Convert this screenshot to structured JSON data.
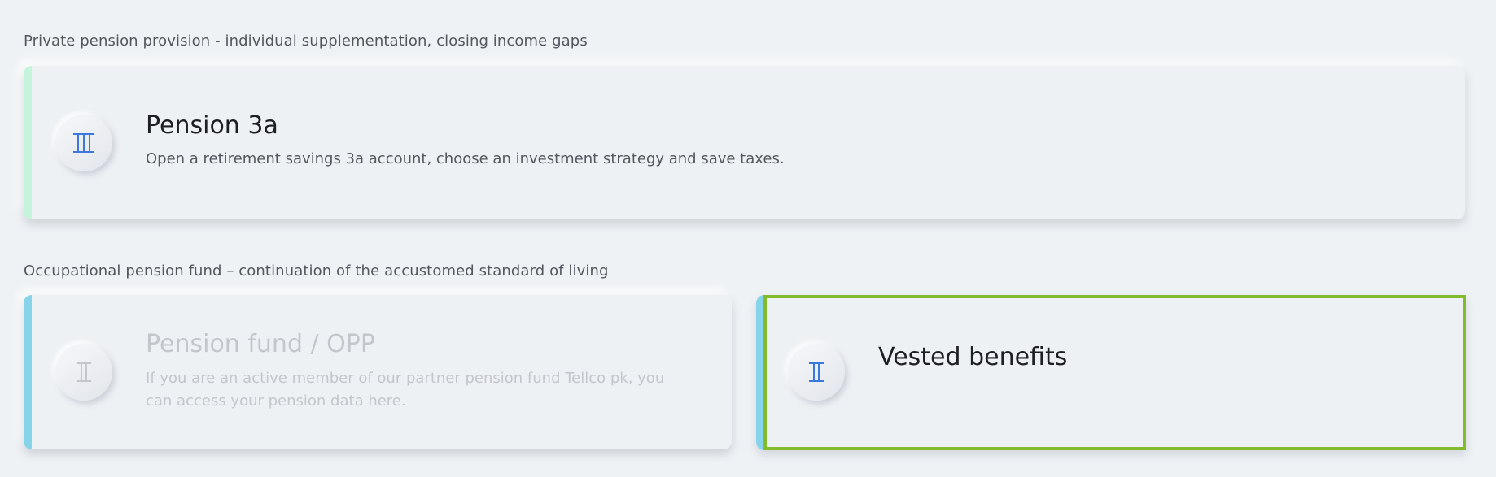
{
  "colors": {
    "background": "#eff2f5",
    "accent_green": "#c4f5dc",
    "accent_blue": "#86d4ea",
    "icon_blue": "#3a78e0",
    "icon_disabled": "#c3c6cc",
    "focus_green": "#82bc2c"
  },
  "sections": [
    {
      "title": "Private pension provision - individual supplementation, closing income gaps",
      "cards": [
        {
          "icon": "pillar-3-icon",
          "title": "Pension 3a",
          "description": "Open a retirement savings 3a account, choose an investment strategy and save taxes.",
          "state": "enabled"
        }
      ]
    },
    {
      "title": "Occupational pension fund – continuation of the accustomed standard of living",
      "cards": [
        {
          "icon": "pillar-2-icon",
          "title": "Pension fund / OPP",
          "description": "If you are an active member of our partner pension fund Tellco pk, you can access your pension data here.",
          "state": "disabled"
        },
        {
          "icon": "pillar-2-icon",
          "title": "Vested benefits",
          "description": "",
          "state": "focused"
        }
      ]
    }
  ]
}
